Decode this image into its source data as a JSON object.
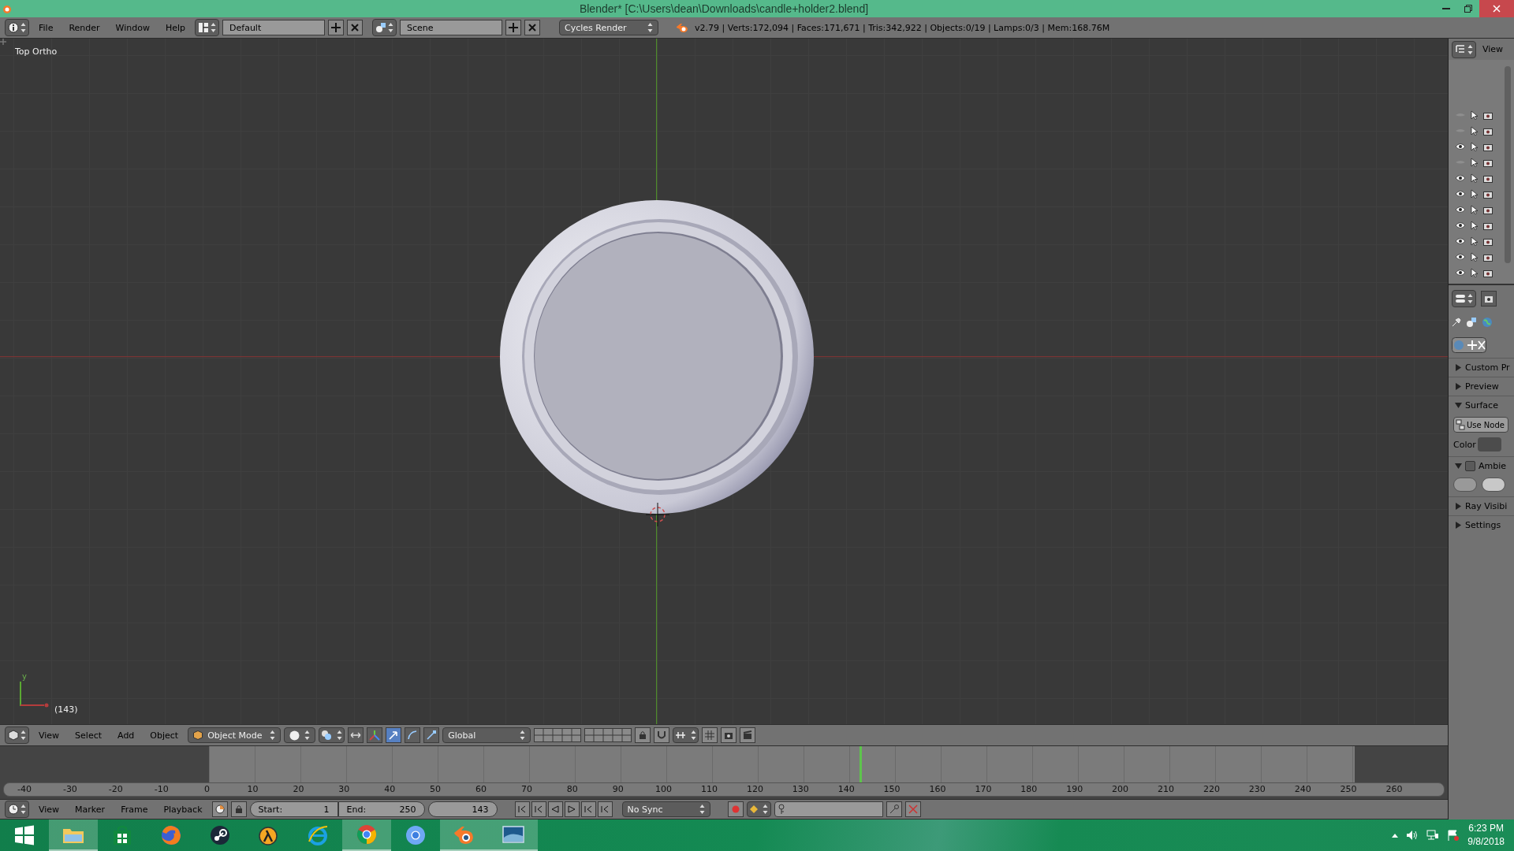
{
  "window": {
    "title": "Blender* [C:\\Users\\dean\\Downloads\\candle+holder2.blend]"
  },
  "info_header": {
    "menus": [
      "File",
      "Render",
      "Window",
      "Help"
    ],
    "screen_layout": "Default",
    "scene": "Scene",
    "render_engine": "Cycles Render",
    "stats": "v2.79 | Verts:172,094 | Faces:171,671 | Tris:342,922 | Objects:0/19 | Lamps:0/3 | Mem:168.76M"
  },
  "viewport": {
    "view_name": "Top Ortho",
    "frame": "(143)",
    "axis_label": "y"
  },
  "outliner": {
    "view_menu": "View",
    "rows": [
      {
        "visible": false
      },
      {
        "visible": false
      },
      {
        "visible": true
      },
      {
        "visible": false
      },
      {
        "visible": true
      },
      {
        "visible": true
      },
      {
        "visible": true
      },
      {
        "visible": true
      },
      {
        "visible": true
      },
      {
        "visible": true
      },
      {
        "visible": true
      }
    ]
  },
  "properties": {
    "panels": [
      {
        "kind": "plain",
        "label": "Custom Pr",
        "expanded": false
      },
      {
        "kind": "plain",
        "label": "Preview",
        "expanded": false
      },
      {
        "kind": "surface",
        "label": "Surface",
        "expanded": true,
        "button": "Use Node",
        "field_label": "Color"
      },
      {
        "kind": "checkbox",
        "label": "Ambie",
        "expanded": true,
        "checked": false
      },
      {
        "kind": "plain",
        "label": "Ray Visibi",
        "expanded": false
      },
      {
        "kind": "plain",
        "label": "Settings",
        "expanded": false
      }
    ]
  },
  "view3d_header": {
    "menus": [
      "View",
      "Select",
      "Add",
      "Object"
    ],
    "mode": "Object Mode",
    "orientation": "Global"
  },
  "timeline": {
    "ruler": [
      "-40",
      "-30",
      "-20",
      "-10",
      "0",
      "10",
      "20",
      "30",
      "40",
      "50",
      "60",
      "70",
      "80",
      "90",
      "100",
      "110",
      "120",
      "130",
      "140",
      "150",
      "160",
      "170",
      "180",
      "190",
      "200",
      "210",
      "220",
      "230",
      "240",
      "250",
      "260"
    ],
    "playhead": {
      "level": 0.61
    }
  },
  "timeline_header": {
    "menus": [
      "View",
      "Marker",
      "Frame",
      "Playback"
    ],
    "start_label": "Start:",
    "start": "1",
    "end_label": "End:",
    "end": "250",
    "current_frame": "143",
    "sync": "No Sync"
  },
  "taskbar": {
    "apps": [
      {
        "kind": "start",
        "active": false
      },
      {
        "kind": "explorer",
        "active": true
      },
      {
        "kind": "store",
        "active": false
      },
      {
        "kind": "firefox",
        "active": false
      },
      {
        "kind": "steam",
        "active": false
      },
      {
        "kind": "lambda",
        "active": false
      },
      {
        "kind": "ie",
        "active": false
      },
      {
        "kind": "chrome",
        "active": true
      },
      {
        "kind": "chromium",
        "active": false
      },
      {
        "kind": "blender",
        "active": true
      },
      {
        "kind": "photos",
        "active": true
      }
    ],
    "time": "6:23 PM",
    "date": "9/8/2018"
  }
}
